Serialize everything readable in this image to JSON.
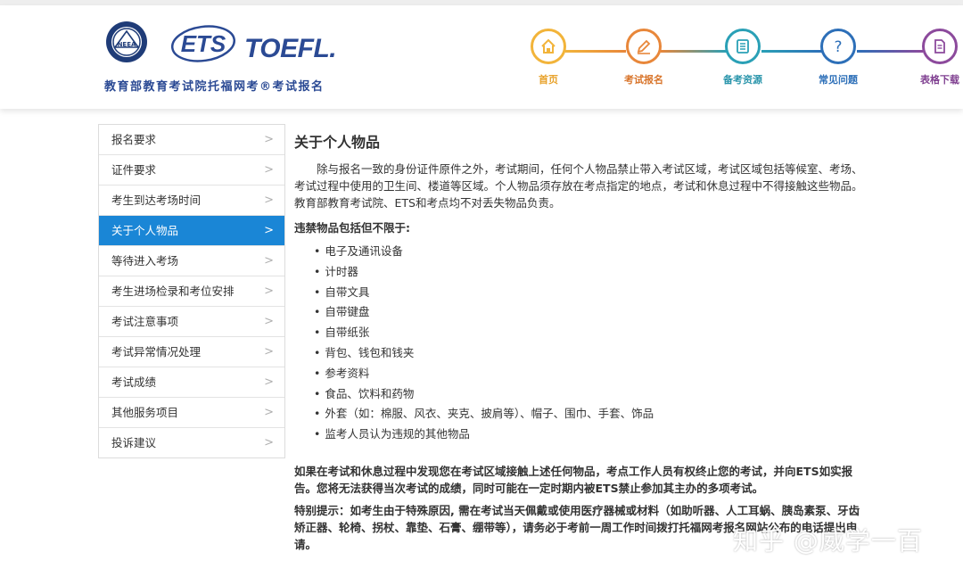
{
  "header": {
    "logo_text": "NEEA",
    "ets_logo_text": "ETS",
    "toefl_logo_text": "TOEFL.",
    "subtitle": "教育部教育考试院托福网考®考试报名"
  },
  "nav": [
    {
      "label": "首页",
      "icon": "home-icon",
      "color": "#f2b43a"
    },
    {
      "label": "考试报名",
      "icon": "edit-icon",
      "color": "#e8873a"
    },
    {
      "label": "备考资源",
      "icon": "book-icon",
      "color": "#2aa0b6"
    },
    {
      "label": "常见问题",
      "icon": "question-icon",
      "color": "#2d6fb8"
    },
    {
      "label": "表格下载",
      "icon": "document-icon",
      "color": "#8c4a9c"
    }
  ],
  "sidebar": {
    "items": [
      {
        "label": "报名要求"
      },
      {
        "label": "证件要求"
      },
      {
        "label": "考生到达考场时间"
      },
      {
        "label": "关于个人物品",
        "active": true
      },
      {
        "label": "等待进入考场"
      },
      {
        "label": "考生进场检录和考位安排"
      },
      {
        "label": "考试注意事项"
      },
      {
        "label": "考试异常情况处理"
      },
      {
        "label": "考试成绩"
      },
      {
        "label": "其他服务项目"
      },
      {
        "label": "投诉建议"
      }
    ],
    "chevron": ">"
  },
  "content": {
    "title": "关于个人物品",
    "intro": "除与报名一致的身份证件原件之外，考试期间，任何个人物品禁止带入考试区域，考试区域包括等候室、考场、考试过程中使用的卫生间、楼道等区域。个人物品须存放在考点指定的地点，考试和休息过程中不得接触这些物品。教育部教育考试院、ETS和考点均不对丢失物品负责。",
    "list_title": "违禁物品包括但不限于:",
    "items": [
      "电子及通讯设备",
      "计时器",
      "自带文具",
      "自带键盘",
      "自带纸张",
      "背包、钱包和钱夹",
      "参考资料",
      "食品、饮料和药物",
      "外套（如：棉服、风衣、夹克、披肩等）、帽子、围巾、手套、饰品",
      "监考人员认为违规的其他物品"
    ],
    "warning": "如果在考试和休息过程中发现您在考试区域接触上述任何物品，考点工作人员有权终止您的考试，并向ETS如实报告。您将无法获得当次考试的成绩，同时可能在一定时期内被ETS禁止参加其主办的多项考试。",
    "special": "特别提示：如考生由于特殊原因, 需在考试当天佩戴或使用医疗器械或材料（如助听器、人工耳蜗、胰岛素泵、牙齿矫正器、轮椅、拐杖、靠垫、石膏、绷带等），请务必于考前一周工作时间拨打托福网考报名网站公布的电话提出申请。"
  },
  "watermark": "知乎 @威学一百"
}
